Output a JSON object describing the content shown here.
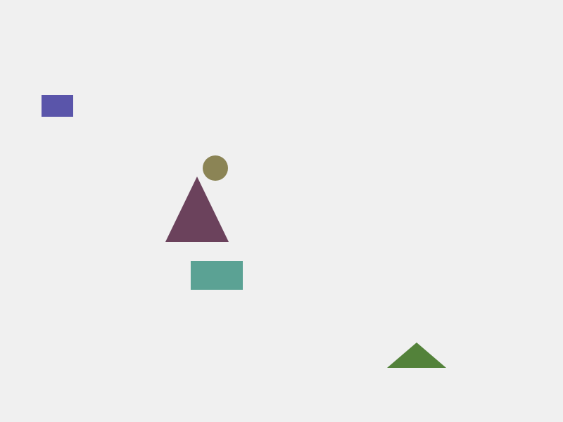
{
  "canvas": {
    "background": "#f0f0f0"
  },
  "shapes": [
    {
      "kind": "rectangle",
      "color": "#5a55aa"
    },
    {
      "kind": "circle",
      "color": "#8b8455"
    },
    {
      "kind": "triangle",
      "color": "#6b425c"
    },
    {
      "kind": "rectangle",
      "color": "#5ba294"
    },
    {
      "kind": "triangle",
      "color": "#53823a"
    }
  ]
}
